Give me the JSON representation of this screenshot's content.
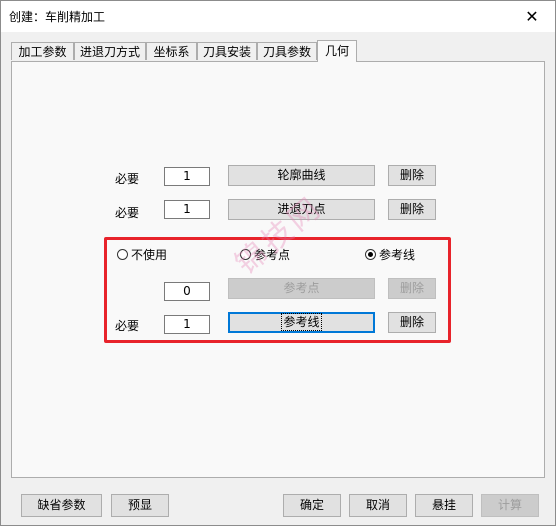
{
  "window": {
    "title": "创建：车削精加工",
    "close_glyph": "✕"
  },
  "tabs": [
    {
      "label": "加工参数"
    },
    {
      "label": "进退刀方式"
    },
    {
      "label": "坐标系"
    },
    {
      "label": "刀具安装"
    },
    {
      "label": "刀具参数"
    },
    {
      "label": "几何",
      "active": true
    }
  ],
  "rows": {
    "profile": {
      "req": "必要",
      "count": "1",
      "button": "轮廓曲线",
      "delete": "删除"
    },
    "approach": {
      "req": "必要",
      "count": "1",
      "button": "进退刀点",
      "delete": "删除"
    }
  },
  "reference": {
    "options": [
      {
        "label": "不使用",
        "selected": false
      },
      {
        "label": "参考点",
        "selected": false
      },
      {
        "label": "参考线",
        "selected": true
      }
    ],
    "point_row": {
      "count": "0",
      "button": "参考点",
      "delete": "删除"
    },
    "line_row": {
      "req": "必要",
      "count": "1",
      "button": "参考线",
      "delete": "删除"
    }
  },
  "watermark": "锦技网",
  "footer": {
    "defaults": "缺省参数",
    "preview": "预显",
    "ok": "确定",
    "cancel": "取消",
    "suspend": "悬挂",
    "calculate": "计算"
  },
  "colors": {
    "highlight_border": "#e8232b",
    "focus": "#0078d7"
  }
}
